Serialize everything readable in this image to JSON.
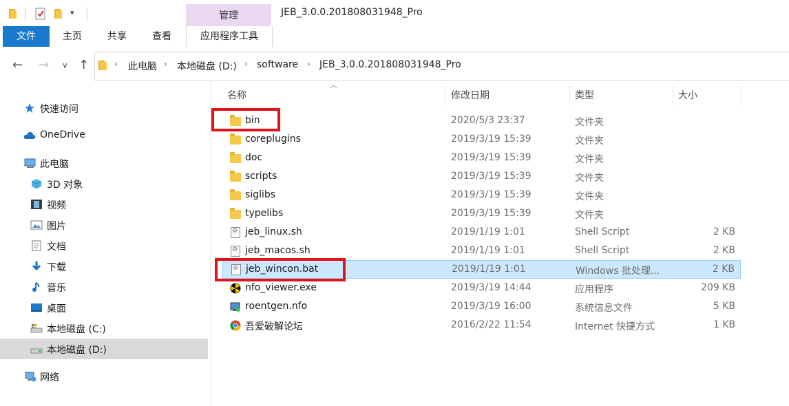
{
  "window": {
    "title": "JEB_3.0.0.201808031948_Pro",
    "context_tab": "管理"
  },
  "ribbon": {
    "tabs": [
      "文件",
      "主页",
      "共享",
      "查看",
      "应用程序工具"
    ]
  },
  "address": {
    "crumbs": [
      "此电脑",
      "本地磁盘 (D:)",
      "software",
      "JEB_3.0.0.201808031948_Pro"
    ]
  },
  "nav": {
    "items": [
      {
        "label": "快速访问",
        "icon": "star-icon"
      },
      {
        "label": "OneDrive",
        "icon": "cloud-icon"
      },
      {
        "label": "此电脑",
        "icon": "computer-icon"
      },
      {
        "label": "3D 对象",
        "icon": "cube-icon"
      },
      {
        "label": "视频",
        "icon": "film-icon"
      },
      {
        "label": "图片",
        "icon": "picture-icon"
      },
      {
        "label": "文档",
        "icon": "document-icon"
      },
      {
        "label": "下载",
        "icon": "download-icon"
      },
      {
        "label": "音乐",
        "icon": "music-icon"
      },
      {
        "label": "桌面",
        "icon": "desktop-icon"
      },
      {
        "label": "本地磁盘 (C:)",
        "icon": "drive-icon"
      },
      {
        "label": "本地磁盘 (D:)",
        "icon": "drive-icon",
        "selected": true
      },
      {
        "label": "网络",
        "icon": "network-icon"
      }
    ]
  },
  "list": {
    "columns": {
      "name": "名称",
      "date": "修改日期",
      "type": "类型",
      "size": "大小"
    },
    "files": [
      {
        "name": "bin",
        "date": "2020/5/3 23:37",
        "type": "文件夹",
        "size": "",
        "icon": "folder-icon"
      },
      {
        "name": "coreplugins",
        "date": "2019/3/19 15:39",
        "type": "文件夹",
        "size": "",
        "icon": "folder-icon"
      },
      {
        "name": "doc",
        "date": "2019/3/19 15:39",
        "type": "文件夹",
        "size": "",
        "icon": "folder-icon"
      },
      {
        "name": "scripts",
        "date": "2019/3/19 15:39",
        "type": "文件夹",
        "size": "",
        "icon": "folder-icon"
      },
      {
        "name": "siglibs",
        "date": "2019/3/19 15:39",
        "type": "文件夹",
        "size": "",
        "icon": "folder-icon"
      },
      {
        "name": "typelibs",
        "date": "2019/3/19 15:39",
        "type": "文件夹",
        "size": "",
        "icon": "folder-icon"
      },
      {
        "name": "jeb_linux.sh",
        "date": "2019/1/19 1:01",
        "type": "Shell Script",
        "size": "2 KB",
        "icon": "script-icon"
      },
      {
        "name": "jeb_macos.sh",
        "date": "2019/1/19 1:01",
        "type": "Shell Script",
        "size": "2 KB",
        "icon": "script-icon"
      },
      {
        "name": "jeb_wincon.bat",
        "date": "2019/1/19 1:01",
        "type": "Windows 批处理...",
        "size": "2 KB",
        "icon": "batch-icon",
        "selected": true
      },
      {
        "name": "nfo_viewer.exe",
        "date": "2019/3/19 14:44",
        "type": "应用程序",
        "size": "209 KB",
        "icon": "exe-icon"
      },
      {
        "name": "roentgen.nfo",
        "date": "2019/3/19 16:00",
        "type": "系统信息文件",
        "size": "5 KB",
        "icon": "nfo-icon"
      },
      {
        "name": "吾爱破解论坛",
        "date": "2016/2/22 11:54",
        "type": "Internet 快捷方式",
        "size": "1 KB",
        "icon": "chrome-icon"
      }
    ]
  },
  "colors": {
    "file_tab": "#1979ca",
    "context_tab": "#ead7f0",
    "selection": "#cce8ff",
    "highlight_box": "#e0121a",
    "folder": "#f5c947"
  }
}
